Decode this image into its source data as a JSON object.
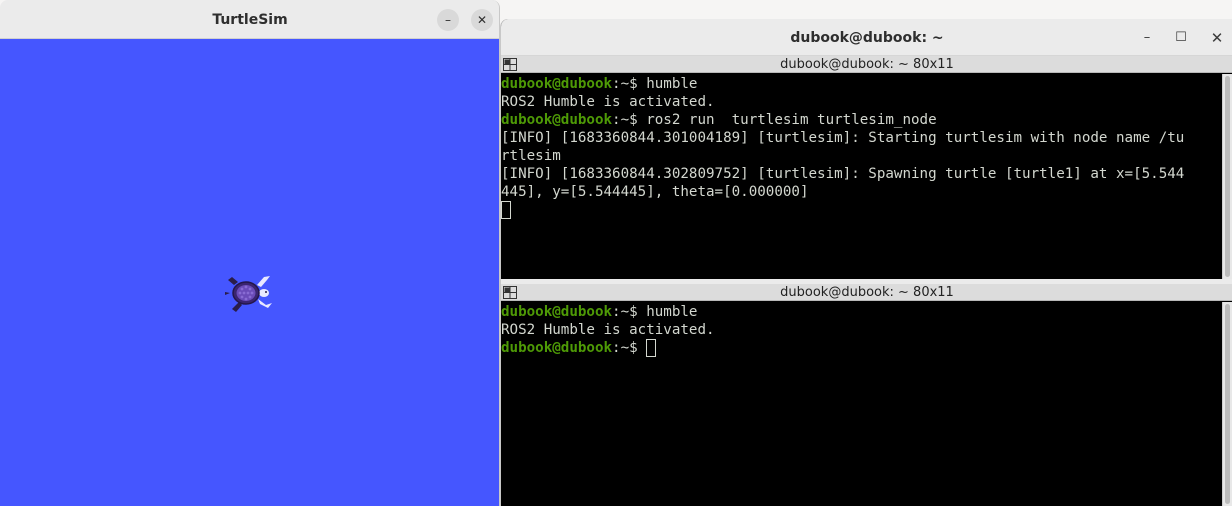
{
  "turtlesim": {
    "title": "TurtleSim",
    "minimize_symbol": "–",
    "close_symbol": "✕",
    "background_color": "#4556ff",
    "turtle_icon": "turtle-icon"
  },
  "terminal": {
    "title": "dubook@dubook: ~",
    "min_symbol": "–",
    "max_symbol": "☐",
    "close_symbol": "✕",
    "panes": [
      {
        "header": "dubook@dubook: ~ 80x11",
        "lines": [
          {
            "prompt": "dubook@dubook",
            "tail": ":~$ ",
            "text": "humble"
          },
          {
            "prompt": "",
            "tail": "",
            "text": "ROS2 Humble is activated."
          },
          {
            "prompt": "dubook@dubook",
            "tail": ":~$ ",
            "text": "ros2 run  turtlesim turtlesim_node"
          },
          {
            "prompt": "",
            "tail": "",
            "text": "[INFO] [1683360844.301004189] [turtlesim]: Starting turtlesim with node name /tu"
          },
          {
            "prompt": "",
            "tail": "",
            "text": "rtlesim"
          },
          {
            "prompt": "",
            "tail": "",
            "text": "[INFO] [1683360844.302809752] [turtlesim]: Spawning turtle [turtle1] at x=[5.544"
          },
          {
            "prompt": "",
            "tail": "",
            "text": "445], y=[5.544445], theta=[0.000000]"
          }
        ]
      },
      {
        "header": "dubook@dubook: ~ 80x11",
        "lines": [
          {
            "prompt": "dubook@dubook",
            "tail": ":~$ ",
            "text": "humble"
          },
          {
            "prompt": "",
            "tail": "",
            "text": "ROS2 Humble is activated."
          },
          {
            "prompt": "dubook@dubook",
            "tail": ":~$ ",
            "text": ""
          }
        ]
      }
    ]
  },
  "colors": {
    "prompt_green": "#4e9a06",
    "terminal_text": "#d3d7cf",
    "terminal_bg": "#000000"
  }
}
